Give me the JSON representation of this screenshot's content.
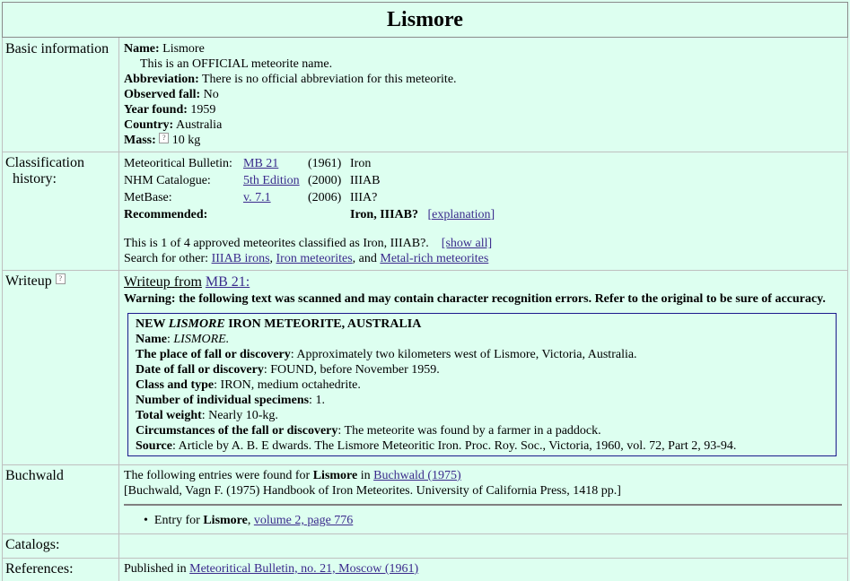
{
  "title": "Lismore",
  "basic": {
    "label": "Basic information",
    "name_label": "Name:",
    "name_value": "Lismore",
    "official_note": "This is an OFFICIAL meteorite name.",
    "abbrev_label": "Abbreviation:",
    "abbrev_value": "There is no official abbreviation for this meteorite.",
    "observed_label": "Observed fall:",
    "observed_value": "No",
    "year_label": "Year found:",
    "year_value": "1959",
    "country_label": "Country:",
    "country_value": "Australia",
    "mass_label": "Mass:",
    "mass_value": "10 kg"
  },
  "classification": {
    "label1": "Classification",
    "label2": "history:",
    "rows": [
      {
        "source": "Meteoritical Bulletin:",
        "ref": "MB 21",
        "year": "(1961)",
        "class": "Iron"
      },
      {
        "source": "NHM Catalogue:",
        "ref": "5th Edition",
        "year": "(2000)",
        "class": "IIIAB"
      },
      {
        "source": "MetBase:",
        "ref": "v. 7.1",
        "year": "(2006)",
        "class": "IIIA?"
      }
    ],
    "recommended_label": "Recommended:",
    "recommended_value": "Iron, IIIAB?",
    "explanation_link": "[explanation]",
    "count_text": "This is 1 of 4 approved meteorites classified as Iron, IIIAB?.",
    "show_all": "[show all]",
    "search_prefix": "Search for other:",
    "search_link1": "IIIAB irons",
    "search_link2": "Iron meteorites",
    "search_and": ", and",
    "search_link3": "Metal-rich meteorites"
  },
  "writeup": {
    "label": "Writeup",
    "from_prefix": "Writeup from",
    "from_link": "MB 21:",
    "warning": "Warning: the following text was scanned and may contain character recognition errors. Refer to the original to be sure of accuracy.",
    "heading_pre": "NEW",
    "heading_italic": "LISMORE",
    "heading_post": "IRON METEORITE, AUSTRALIA",
    "fields": [
      {
        "label": "Name",
        "value": "LISMORE."
      },
      {
        "label": "The place of fall or discovery",
        "value": "Approximately two kilometers west of Lismore, Victoria, Australia."
      },
      {
        "label": "Date of fall or discovery",
        "value": "FOUND, before November 1959."
      },
      {
        "label": "Class and type",
        "value": "IRON, medium octahedrite."
      },
      {
        "label": "Number of individual specimens",
        "value": "1."
      },
      {
        "label": "Total weight",
        "value": "Nearly 10-kg."
      },
      {
        "label": "Circumstances of the fall or discovery",
        "value": "The meteorite was found by a farmer in a paddock."
      },
      {
        "label": "Source",
        "value": "Article by A. B. E dwards. The Lismore Meteoritic Iron. Proc. Roy. Soc., Victoria, 1960, vol. 72, Part 2, 93-94."
      }
    ]
  },
  "buchwald": {
    "label": "Buchwald",
    "intro_pre": "The following entries were found for",
    "intro_name": "Lismore",
    "intro_in": "in",
    "intro_link": "Buchwald (1975)",
    "citation": "[Buchwald, Vagn F. (1975) Handbook of Iron Meteorites. University of California Press, 1418 pp.]",
    "entry_pre": "Entry for",
    "entry_name": "Lismore",
    "entry_link": "volume 2, page 776"
  },
  "catalogs": {
    "label": "Catalogs:"
  },
  "references": {
    "label": "References:",
    "pub_prefix": "Published in",
    "pub_link": "Meteoritical Bulletin, no. 21, Moscow (1961)"
  }
}
